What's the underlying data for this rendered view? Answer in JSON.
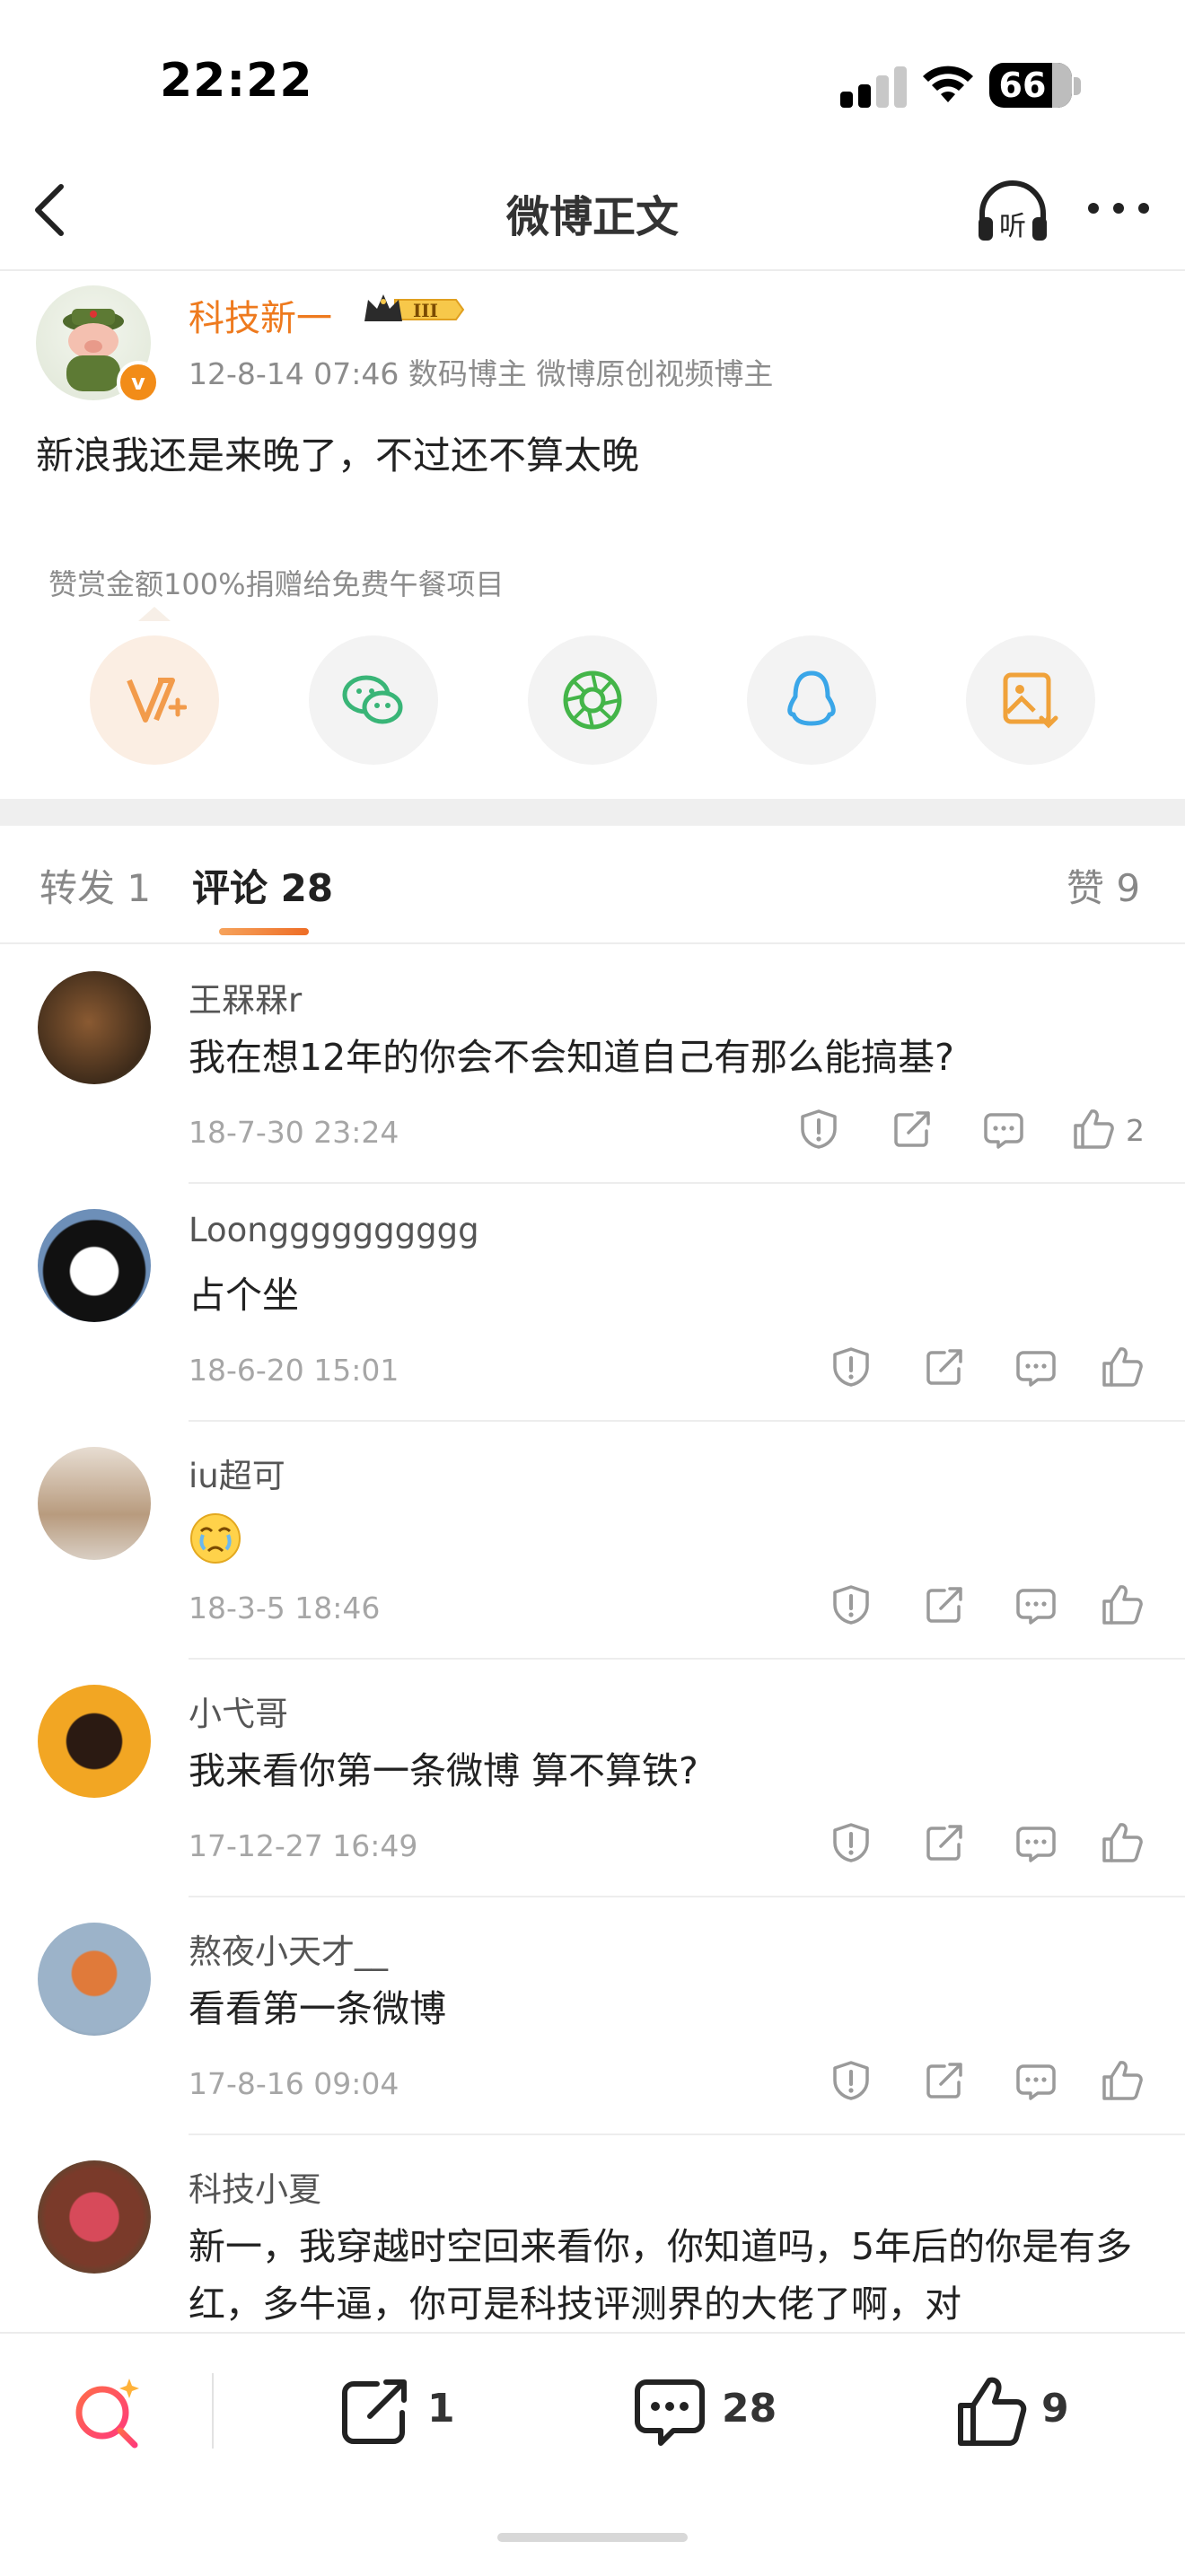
{
  "status_bar": {
    "time": "22:22",
    "battery": "66"
  },
  "nav": {
    "title": "微博正文"
  },
  "post": {
    "author_name": "科技新一",
    "level_badge": "III",
    "meta": "12-8-14 07:46  数码博主 微博原创视频博主",
    "text": "新浪我还是来晚了，不过还不算太晚",
    "reward_text": "赞赏金额100%捐赠给免费午餐项目"
  },
  "tabs": {
    "repost": "转发 1",
    "comment": "评论 28",
    "like": "赞 9"
  },
  "comments": [
    {
      "name": "王槑槑r",
      "text": "我在想12年的你会不会知道自己有那么能搞基?",
      "time": "18-7-30 23:24",
      "likes": "2"
    },
    {
      "name": "Loongggggggggg",
      "text": "占个坐",
      "time": "18-6-20 15:01",
      "likes": ""
    },
    {
      "name": "iu超可",
      "text": "",
      "time": "18-3-5 18:46",
      "likes": ""
    },
    {
      "name": "小弋哥",
      "text": "我来看你第一条微博 算不算铁?",
      "time": "17-12-27 16:49",
      "likes": ""
    },
    {
      "name": "熬夜小天才__",
      "text": "看看第一条微博",
      "time": "17-8-16 09:04",
      "likes": ""
    },
    {
      "name": "科技小夏",
      "text": "新一，我穿越时空回来看你，你知道吗，5年后的你是有多红，多牛逼，你可是科技评测界的大佬了啊，对",
      "time": "",
      "likes": ""
    }
  ],
  "bottom_bar": {
    "repost_count": "1",
    "comment_count": "28",
    "like_count": "9"
  },
  "colors": {
    "accent": "#ee7a1e",
    "weibo_orange": "#f28c18"
  }
}
